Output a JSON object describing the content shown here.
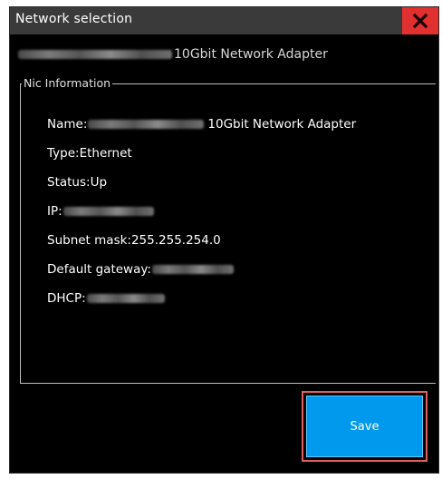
{
  "window": {
    "title": "Network selection",
    "close_icon": "close-icon"
  },
  "adapter": {
    "name_suffix": "10Gbit Network Adapter"
  },
  "nic_info": {
    "legend": "Nic Information",
    "name_label": "Name:",
    "name_suffix": "10Gbit Network Adapter",
    "type_label": "Type:",
    "type_value": "Ethernet",
    "status_label": "Status:",
    "status_value": "Up",
    "ip_label": "IP:",
    "subnet_label": "Subnet mask:",
    "subnet_value": "255.255.254.0",
    "gateway_label": "Default gateway:",
    "dhcp_label": "DHCP:"
  },
  "actions": {
    "save_label": "Save"
  },
  "colors": {
    "titlebar": "#3a3a3a",
    "close": "#e03030",
    "save": "#0099ee",
    "highlight": "#e06060"
  }
}
